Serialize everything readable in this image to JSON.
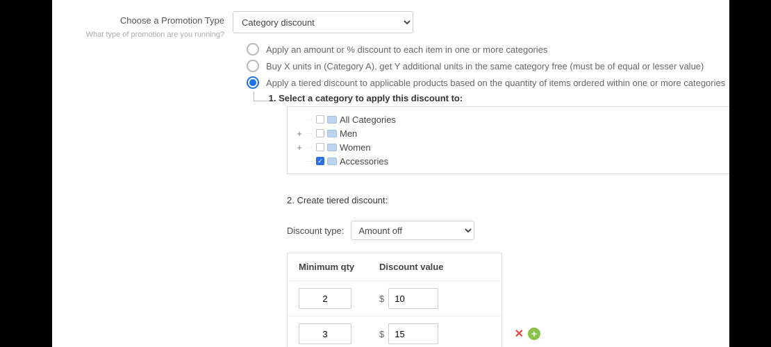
{
  "form": {
    "label_title": "Choose a Promotion Type",
    "label_help": "What type of promotion are you running?",
    "promo_type_selected": "Category discount",
    "radio_options": [
      "Apply an amount or % discount to each item in one or more categories",
      "Buy X units in (Category A), get Y additional units in the same category free (must be of equal or lesser value)",
      "Apply a tiered discount to applicable products based on the quantity of items ordered within one or more categories"
    ],
    "selected_radio_index": 2,
    "step1_title": "1. Select a category to apply this discount to:",
    "categories": [
      {
        "label": "All Categories",
        "checked": false,
        "expandable": false
      },
      {
        "label": "Men",
        "checked": false,
        "expandable": true
      },
      {
        "label": "Women",
        "checked": false,
        "expandable": true
      },
      {
        "label": "Accessories",
        "checked": true,
        "expandable": false
      }
    ],
    "step2_title": "2. Create tiered discount:",
    "discount_type_label": "Discount type:",
    "discount_type_selected": "Amount off",
    "table_headers": {
      "col1": "Minimum qty",
      "col2": "Discount value"
    },
    "currency_symbol": "$",
    "tiers": [
      {
        "qty": "2",
        "value": "10",
        "show_actions": false
      },
      {
        "qty": "3",
        "value": "15",
        "show_actions": true
      }
    ]
  }
}
